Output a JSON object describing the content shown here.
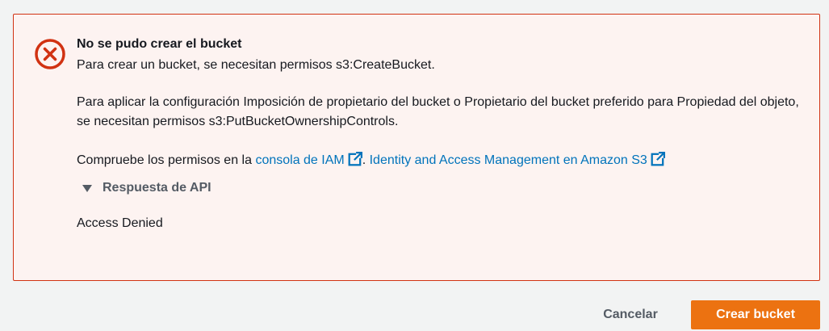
{
  "alert": {
    "title": "No se pudo crear el bucket",
    "line1": "Para crear un bucket, se necesitan permisos s3:CreateBucket.",
    "line2": "Para aplicar la configuración Imposición de propietario del bucket o Propietario del bucket preferido para Propiedad del objeto, se necesitan permisos s3:PutBucketOwnershipControls.",
    "check_prefix": "Compruebe los permisos en la ",
    "iam_link": "consola de IAM",
    "separator": ". ",
    "iam_s3_link": "Identity and Access Management en Amazon S3",
    "expander_label": "Respuesta de API",
    "api_response": "Access Denied",
    "icon": "error-circle-x-icon",
    "color": "#d13212",
    "background": "#fdf3f1"
  },
  "footer": {
    "cancel_label": "Cancelar",
    "create_label": "Crear bucket",
    "primary_color": "#ec7211"
  },
  "colors": {
    "link": "#0073bb",
    "page_background": "#f2f3f3"
  }
}
